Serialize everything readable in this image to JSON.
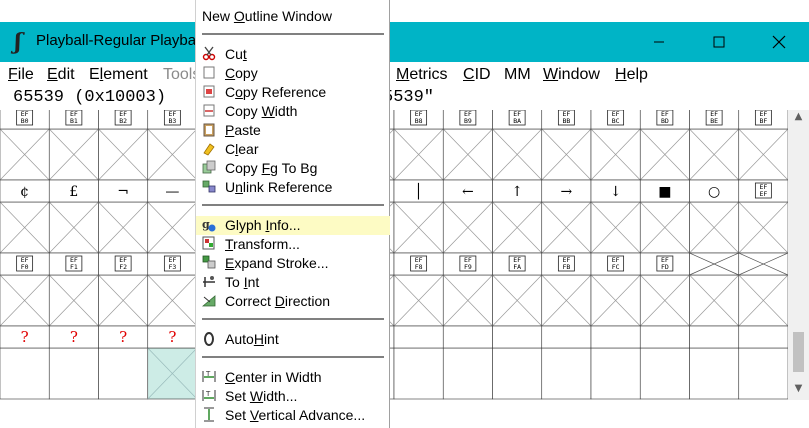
{
  "window": {
    "title": "Playball-Regular  Playba",
    "min_icon": "minimize-icon",
    "max_icon": "maximize-icon",
    "close_icon": "close-icon",
    "accent": "#00b4c6"
  },
  "menubar": {
    "file": "File",
    "edit": "Edit",
    "element": "Element",
    "tools": "Tools",
    "metrics": "Metrics",
    "cid": "CID",
    "mm": "MM",
    "window": "Window",
    "help": "Help"
  },
  "info": {
    "left": "65539 (0x10003)",
    "right": "5539\""
  },
  "grid": {
    "row_labels": [
      [
        "EF\nB0",
        "EF\nB1",
        "EF\nB2",
        "EF\nB3",
        "",
        "",
        "",
        "",
        "EF\nB8",
        "EF\nB9",
        "EF\nBA",
        "EF\nBB",
        "EF\nBC",
        "EF\nBD",
        "EF\nBE",
        "EF\nBF"
      ],
      [
        "¢",
        "£",
        "¬",
        "—",
        "",
        "",
        "",
        "",
        "│",
        "←",
        "↑",
        "→",
        "↓",
        "■",
        "○",
        "EF\nEF"
      ],
      [
        "EF\nF0",
        "EF\nF1",
        "EF\nF2",
        "EF\nF3",
        "",
        "",
        "",
        "",
        "EF\nF8",
        "EF\nF9",
        "EF\nFA",
        "EF\nFB",
        "EF\nFC",
        "EF\nFD",
        "",
        ""
      ],
      [
        "?",
        "?",
        "?",
        "?",
        "",
        "",
        "",
        "",
        "",
        "",
        "",
        "",
        "",
        "",
        "",
        ""
      ]
    ],
    "question_color": "#e00000",
    "selected_color": "#cdece6"
  },
  "context_menu": {
    "items": [
      {
        "label": "New Outline Window",
        "icon": ""
      },
      {
        "label": "Cut",
        "icon": "scissors-icon"
      },
      {
        "label": "Copy",
        "icon": "copy-icon"
      },
      {
        "label": "Copy Reference",
        "icon": "copy-reference-icon"
      },
      {
        "label": "Copy Width",
        "icon": "copy-width-icon"
      },
      {
        "label": "Paste",
        "icon": "paste-icon"
      },
      {
        "label": "Clear",
        "icon": "clear-icon"
      },
      {
        "label": "Copy Fg To Bg",
        "icon": "copy-fg-bg-icon"
      },
      {
        "label": "Unlink Reference",
        "icon": "unlink-reference-icon"
      },
      {
        "label": "Glyph Info...",
        "icon": "glyph-info-icon"
      },
      {
        "label": "Transform...",
        "icon": "transform-icon"
      },
      {
        "label": "Expand Stroke...",
        "icon": "expand-stroke-icon"
      },
      {
        "label": "To Int",
        "icon": "to-int-icon"
      },
      {
        "label": "Correct Direction",
        "icon": "correct-direction-icon"
      },
      {
        "label": "AutoHint",
        "icon": "autohint-icon"
      },
      {
        "label": "Center in Width",
        "icon": "center-width-icon"
      },
      {
        "label": "Set Width...",
        "icon": "set-width-icon"
      },
      {
        "label": "Set Vertical Advance...",
        "icon": "set-vertical-advance-icon"
      }
    ],
    "highlight_color": "#fdfbc4"
  }
}
